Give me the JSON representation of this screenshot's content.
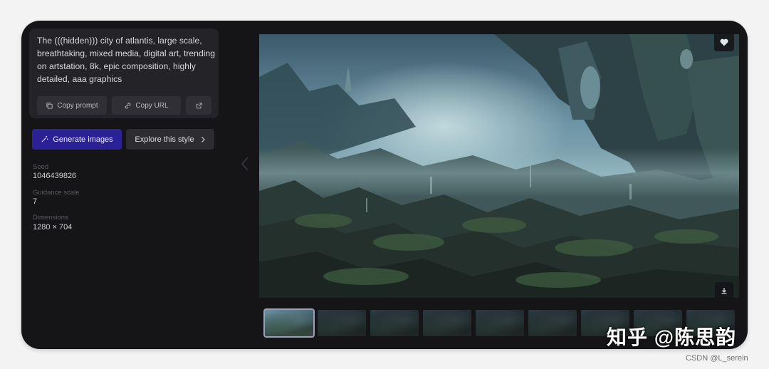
{
  "prompt": {
    "text": "The (((hidden))) city of atlantis, large scale, breathtaking, mixed media, digital art, trending on artstation, 8k, epic composition, highly detailed, aaa graphics",
    "copy_prompt_label": "Copy prompt",
    "copy_url_label": "Copy URL",
    "open_icon": "external-link-icon"
  },
  "actions": {
    "generate_label": "Generate images",
    "explore_label": "Explore this style"
  },
  "details": {
    "seed_label": "Seed",
    "seed_value": "1046439826",
    "guidance_label": "Guidance scale",
    "guidance_value": "7",
    "dimensions_label": "Dimensions",
    "dimensions_value": "1280 × 704"
  },
  "viewer": {
    "image_alt": "The (((hidden))) city of atlantis",
    "favorite_icon": "heart-icon",
    "download_icon": "download-icon",
    "thumbnail_count": 9,
    "active_thumbnail": 1
  },
  "watermark": {
    "text": "知乎 @陈思韵",
    "csdn": "CSDN @L_serein"
  },
  "colors": {
    "card_bg": "#151518",
    "panel_bg": "#232328",
    "generate_bg": "#2b2196",
    "button_bg": "#2c2c31"
  }
}
